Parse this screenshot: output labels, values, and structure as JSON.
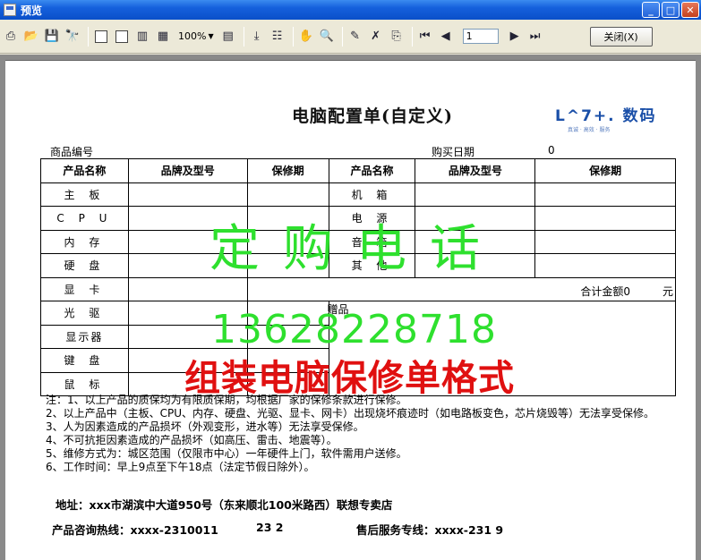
{
  "window": {
    "title": "预览"
  },
  "toolbar": {
    "zoom": "100%",
    "page": "1",
    "close_label": "关闭(X)"
  },
  "document": {
    "title": "电脑配置单(自定义)",
    "logo_text": "L^7+.  数码",
    "logo_sub": "真诚 · 高效 · 服务",
    "product_no_label": "商品编号",
    "purchase_date_label": "购买日期",
    "purchase_date_value": "0",
    "headers": [
      "产品名称",
      "品牌及型号",
      "保修期",
      "产品名称",
      "品牌及型号",
      "保修期"
    ],
    "left_items": [
      "主 板",
      "C P U",
      "内 存",
      "硬 盘",
      "显 卡",
      "光 驱",
      "显示器",
      "键 盘",
      "鼠 标"
    ],
    "right_items": [
      "机 箱",
      "电 源",
      "音 箱",
      "其 他"
    ],
    "total_label": "合计金额0",
    "total_unit": "元",
    "gift_label": "赠品",
    "notes": [
      "注：1、以上产品的质保均为有限质保期，均根据厂家的保修条款进行保修。",
      "2、以上产品中（主板、CPU、内存、硬盘、光驱、显卡、网卡）出现烧坏痕迹时（如电路板变色，芯片烧毁等）无法享受保修。",
      "3、人为因素造成的产品损坏（外观变形，进水等）无法享受保修。",
      "4、不可抗拒因素造成的产品损坏（如高压、雷击、地震等）。",
      "5、维修方式为：城区范围（仅限市中心）一年硬件上门，软件需用户送修。",
      "6、工作时间：早上9点至下午18点（法定节假日除外）。"
    ],
    "address": "地址：xxx市湖滨中大道950号（东来顺北100米路西）联想专卖店",
    "hotline_label": "产品咨询热线：xxxx-2310011",
    "hotline_extra": "23  2",
    "service_label": "售后服务专线：xxxx-231    9"
  },
  "watermark": {
    "line1": "定购电话",
    "line2": "13628228718",
    "line3": "组装电脑保修单格式"
  },
  "colors": {
    "titlebar": "#0a4fc9",
    "watermark_green": "#2ee02e",
    "watermark_red": "#e01010"
  }
}
